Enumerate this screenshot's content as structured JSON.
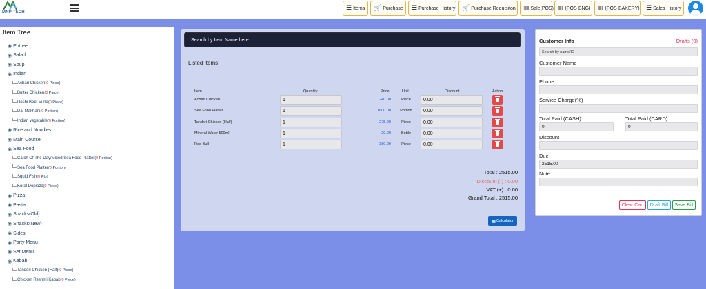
{
  "brand": {
    "logo_text": "MNP TECH"
  },
  "nav": [
    {
      "label": "Items",
      "icon": "list-icon"
    },
    {
      "label": "Purchase",
      "icon": "cart-icon"
    },
    {
      "label": "Purchase History",
      "icon": "list-icon"
    },
    {
      "label": "Purchase Requisiton",
      "icon": "cart-icon"
    },
    {
      "label": "Sale(POS)",
      "icon": "barcode-icon"
    },
    {
      "label": "(POS-BNG)",
      "icon": "barcode-icon"
    },
    {
      "label": "(POS-BAKERY)",
      "icon": "barcode-icon"
    },
    {
      "label": "Sales History",
      "icon": "list-icon"
    }
  ],
  "tree": {
    "title": "Item Tree",
    "rows": [
      {
        "type": "cat",
        "label": "Entree"
      },
      {
        "type": "cat",
        "label": "Salad"
      },
      {
        "type": "cat",
        "label": "Soup"
      },
      {
        "type": "cat",
        "label": "Indian"
      },
      {
        "type": "item",
        "label": "Achari Chicken",
        "qty": "0",
        "unit": "Piece"
      },
      {
        "type": "item",
        "label": "Butter Chicken",
        "qty": "0",
        "unit": "Piece"
      },
      {
        "type": "item",
        "label": "Deshi Beef Vuna",
        "qty": "0",
        "unit": "Piece"
      },
      {
        "type": "item",
        "label": "Dal Makhani",
        "qty": "0",
        "unit": "Portion"
      },
      {
        "type": "item",
        "label": "Indian vegetable",
        "qty": "0",
        "unit": "Portion"
      },
      {
        "type": "cat",
        "label": "Rice and Noodles"
      },
      {
        "type": "cat",
        "label": "Main Course"
      },
      {
        "type": "cat",
        "label": "Sea Food"
      },
      {
        "type": "item",
        "label": "Catch Of The Day/Mixed Sea Food Platter",
        "qty": "0",
        "unit": "Portion"
      },
      {
        "type": "item",
        "label": "Sea Food Platter",
        "qty": "0",
        "unit": "Portion"
      },
      {
        "type": "item",
        "label": "Squid Fish",
        "qty": "0",
        "unit": "KG"
      },
      {
        "type": "item",
        "label": "Koral Dopiaza",
        "qty": "0",
        "unit": "Piece"
      },
      {
        "type": "cat",
        "label": "Pizza"
      },
      {
        "type": "cat",
        "label": "Pasta"
      },
      {
        "type": "cat",
        "label": "Snacks(Old)"
      },
      {
        "type": "cat",
        "label": "Snacks(New)"
      },
      {
        "type": "cat",
        "label": "Sides"
      },
      {
        "type": "cat",
        "label": "Party Menu"
      },
      {
        "type": "cat",
        "label": "Set Menu"
      },
      {
        "type": "cat",
        "label": "Kabab"
      },
      {
        "type": "item",
        "label": "Tandori Chicken (Half)",
        "qty": "0",
        "unit": "Piece"
      },
      {
        "type": "item",
        "label": "Chicken Reshmi Kabab",
        "qty": "0",
        "unit": "Piece"
      }
    ]
  },
  "cart": {
    "search_placeholder": "Search by Item Name here...",
    "listed_label": "Listed Items",
    "headers": {
      "item": "Item",
      "quantity": "Quantity",
      "price": "Price",
      "unit": "Unit",
      "discount": "Discount",
      "action": "Action"
    },
    "rows": [
      {
        "item": "Achari Chicken",
        "quantity": "1",
        "price": "240.00",
        "unit": "Piece",
        "discount": "0.00"
      },
      {
        "item": "Sea Food Platter",
        "quantity": "1",
        "price": "1600.00",
        "unit": "Portion",
        "discount": "0.00"
      },
      {
        "item": "Tandori Chicken (Half)",
        "quantity": "1",
        "price": "275.00",
        "unit": "Piece",
        "discount": "0.00"
      },
      {
        "item": "Mineral Water 500ml",
        "quantity": "1",
        "price": "20.00",
        "unit": "Bottle",
        "discount": "0.00"
      },
      {
        "item": "Red Bull",
        "quantity": "1",
        "price": "380.00",
        "unit": "Piece",
        "discount": "0.00"
      }
    ],
    "total": "Total : 2515.00",
    "discount": "Discount (-) : 0.00",
    "vat": "VAT (+) : 0.00",
    "grand_total": "Grand Total : 2515.00",
    "calculator_label": "Calculator"
  },
  "customer": {
    "title": "Customer Info",
    "drafts": "Drafts (0)",
    "search_placeholder": "Search by name/ID",
    "customer_name_label": "Customer Name",
    "phone_label": "Phone",
    "service_charge_label": "Service Charge(%)",
    "paid_cash_label": "Total Paid (CASH)",
    "paid_cash_value": "0",
    "paid_card_label": "Total Paid (CARD)",
    "paid_card_value": "0",
    "discount_label": "Discount",
    "due_label": "Due",
    "due_value": "2515.00",
    "note_label": "Note",
    "clear_label": "Clear Cart",
    "draft_label": "Draft Bill",
    "save_label": "Save Bill"
  },
  "colors": {
    "accent": "#1565c0",
    "danger": "#e24a4a",
    "nav_border": "#e0b84a",
    "panel": "#cfd6f0",
    "background": "#7b8fe8"
  }
}
